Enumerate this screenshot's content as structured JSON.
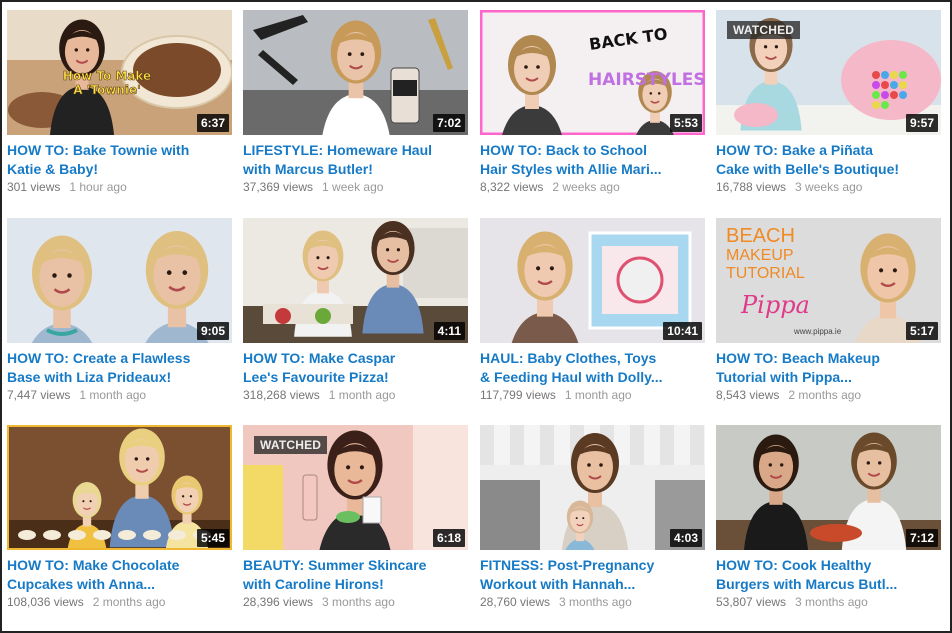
{
  "videos": [
    {
      "title": "HOW TO: Bake Townie with\nKatie & Baby!",
      "views": "301 views",
      "ago": "1 hour ago",
      "duration": "6:37",
      "watched": "",
      "thumb_text": "How To Make\nA 'Townie'",
      "colors": {
        "bg": "#c9a27a",
        "accent": "#7a4a2a",
        "skin": "#e8b89a",
        "hair": "#2a1a12",
        "top": "#222222"
      }
    },
    {
      "title": "LIFESTYLE: Homeware Haul\nwith Marcus Butler!",
      "views": "37,369 views",
      "ago": "1 week ago",
      "duration": "7:02",
      "watched": "",
      "thumb_text": "",
      "colors": {
        "bg": "#b9bcc0",
        "accent": "#3a3a3a",
        "skin": "#e9c4a8",
        "hair": "#c89a5a",
        "top": "#ffffff"
      }
    },
    {
      "title": "HOW TO: Back to School\nHair Styles with Allie Mari...",
      "views": "8,322 views",
      "ago": "2 weeks ago",
      "duration": "5:53",
      "watched": "",
      "thumb_text": "BACK TO SCHOOL HAIRSTYLES",
      "colors": {
        "bg": "#f4f0f2",
        "accent": "#ff66cc",
        "skin": "#f0cdb5",
        "hair": "#b08850",
        "top": "#3b3b3b"
      }
    },
    {
      "title": "HOW TO: Bake a Piñata\nCake with Belle's Boutique!",
      "views": "16,788 views",
      "ago": "3 weeks ago",
      "duration": "9:57",
      "watched": "WATCHED",
      "thumb_text": "",
      "colors": {
        "bg": "#d8e2ea",
        "accent": "#f4b8c8",
        "skin": "#f2d0ba",
        "hair": "#8a6a4a",
        "top": "#a8d8e0"
      }
    },
    {
      "title": "HOW TO: Create a Flawless\nBase with Liza Prideaux!",
      "views": "7,447 views",
      "ago": "1 month ago",
      "duration": "9:05",
      "watched": "",
      "thumb_text": "",
      "colors": {
        "bg": "#dfe6ee",
        "accent": "#3aa6a0",
        "skin": "#e9c2a6",
        "hair": "#e0c080",
        "top": "#9fb8d0"
      }
    },
    {
      "title": "HOW TO: Make Caspar\nLee's Favourite Pizza!",
      "views": "318,268 views",
      "ago": "1 month ago",
      "duration": "4:11",
      "watched": "",
      "thumb_text": "",
      "colors": {
        "bg": "#ece8e2",
        "accent": "#c43a3a",
        "skin": "#e6bfa2",
        "hair": "#4a3020",
        "top": "#6a8ab8"
      }
    },
    {
      "title": "HAUL: Baby Clothes, Toys\n& Feeding Haul with Dolly...",
      "views": "117,799 views",
      "ago": "1 month ago",
      "duration": "10:41",
      "watched": "",
      "thumb_text": "",
      "colors": {
        "bg": "#e6e4e8",
        "accent": "#e05070",
        "skin": "#efcab0",
        "hair": "#d8b070",
        "top": "#7a5a4a"
      }
    },
    {
      "title": "HOW TO: Beach Makeup\nTutorial with Pippa...",
      "views": "8,543 views",
      "ago": "2 months ago",
      "duration": "5:17",
      "watched": "",
      "thumb_text": "BEACH\nMAKEUP\nTUTORIAL",
      "colors": {
        "bg": "#dcdcdc",
        "accent": "#f08a24",
        "skin": "#efc6a8",
        "hair": "#d8b070",
        "top": "#e8d8c8"
      }
    },
    {
      "title": "HOW TO: Make Chocolate\nCupcakes with Anna...",
      "views": "108,036 views",
      "ago": "2 months ago",
      "duration": "5:45",
      "watched": "",
      "thumb_text": "",
      "colors": {
        "bg": "#7a5030",
        "accent": "#f0c040",
        "skin": "#f0ccae",
        "hair": "#e8d080",
        "top": "#6a8ab8"
      }
    },
    {
      "title": "BEAUTY: Summer Skincare\nwith Caroline Hirons!",
      "views": "28,396 views",
      "ago": "3 months ago",
      "duration": "6:18",
      "watched": "WATCHED",
      "thumb_text": "",
      "colors": {
        "bg": "#f0c8c0",
        "accent": "#f4e040",
        "skin": "#e8b898",
        "hair": "#3a2018",
        "top": "#2a2a2a"
      }
    },
    {
      "title": "FITNESS: Post-Pregnancy\nWorkout with Hannah...",
      "views": "28,760 views",
      "ago": "3 months ago",
      "duration": "4:03",
      "watched": "",
      "thumb_text": "",
      "colors": {
        "bg": "#eeeeee",
        "accent": "#888888",
        "skin": "#e9c0a2",
        "hair": "#5a3a22",
        "top": "#d8d0c4"
      }
    },
    {
      "title": "HOW TO: Cook Healthy\nBurgers with Marcus Butl...",
      "views": "53,807 views",
      "ago": "3 months ago",
      "duration": "7:12",
      "watched": "",
      "thumb_text": "",
      "colors": {
        "bg": "#c8cac6",
        "accent": "#c84a2a",
        "skin": "#e6bea0",
        "hair": "#6a4a2a",
        "top": "#222222"
      }
    }
  ],
  "pippa_logo": "Pippa",
  "pippa_url": "www.pippa.ie",
  "link_color": "#167ac6"
}
